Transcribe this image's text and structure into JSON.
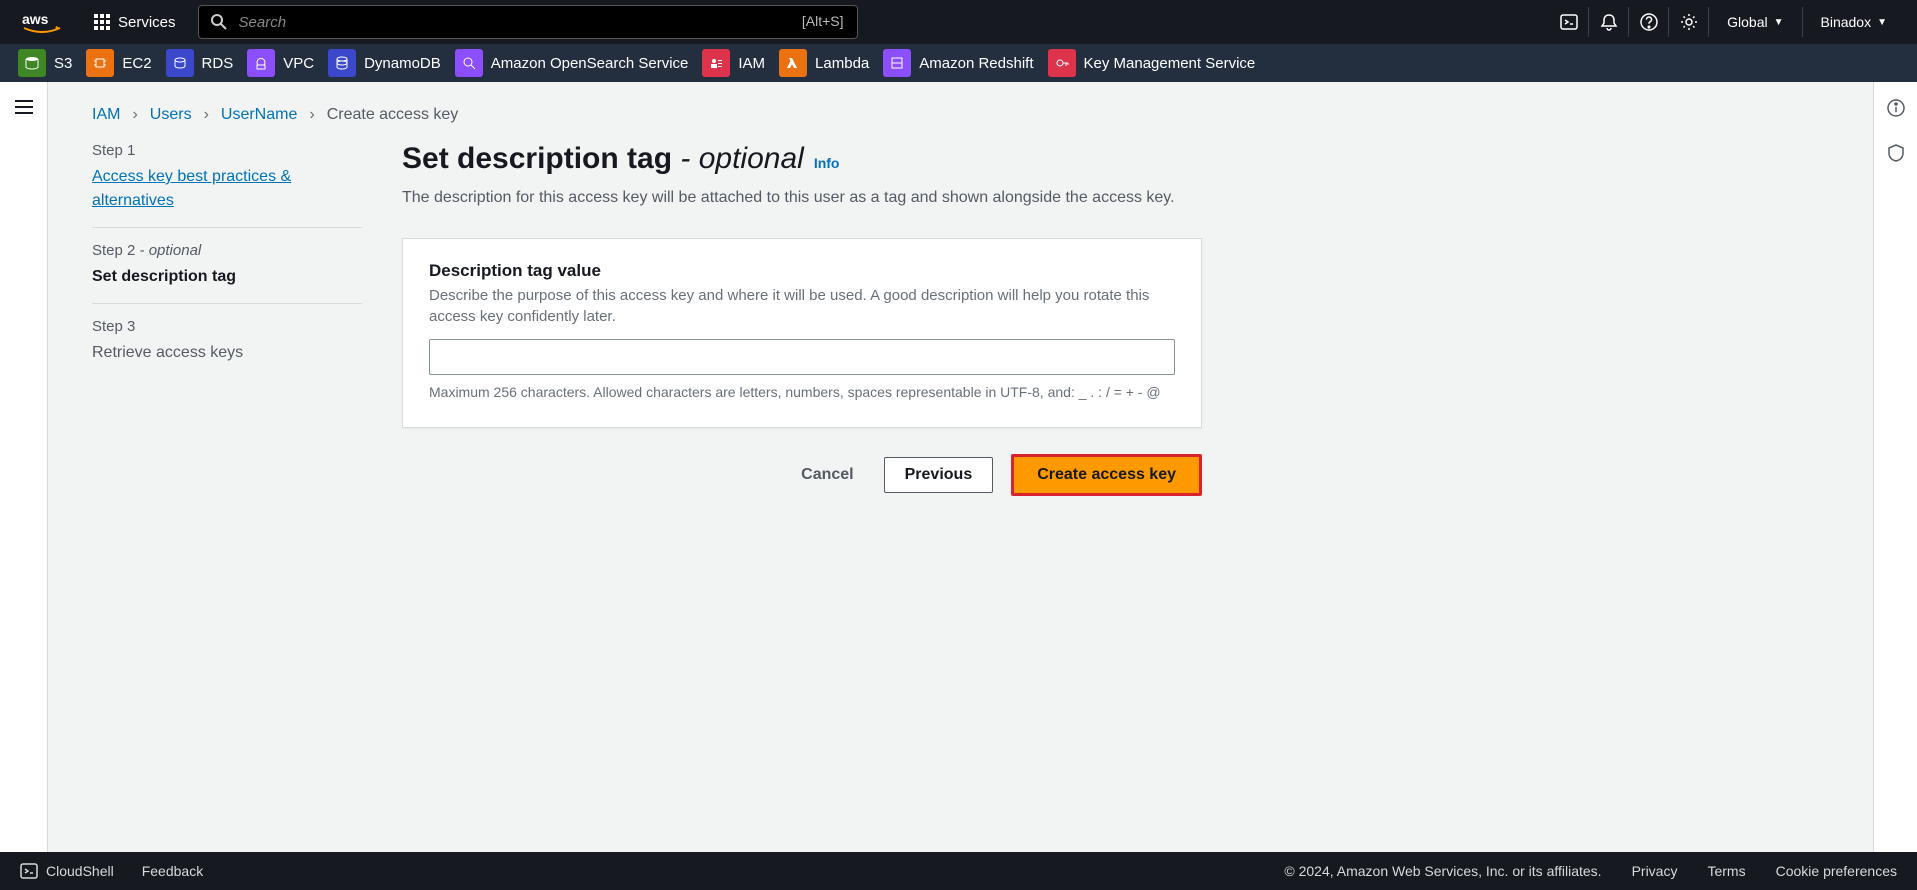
{
  "topnav": {
    "services_label": "Services",
    "search_placeholder": "Search",
    "search_shortcut": "[Alt+S]",
    "region_label": "Global",
    "account_label": "Binadox"
  },
  "service_shortcuts": [
    {
      "name": "S3",
      "icon_class": "svc-s3"
    },
    {
      "name": "EC2",
      "icon_class": "svc-ec2"
    },
    {
      "name": "RDS",
      "icon_class": "svc-rds"
    },
    {
      "name": "VPC",
      "icon_class": "svc-vpc"
    },
    {
      "name": "DynamoDB",
      "icon_class": "svc-dynamo"
    },
    {
      "name": "Amazon OpenSearch Service",
      "icon_class": "svc-opensearch"
    },
    {
      "name": "IAM",
      "icon_class": "svc-iam"
    },
    {
      "name": "Lambda",
      "icon_class": "svc-lambda"
    },
    {
      "name": "Amazon Redshift",
      "icon_class": "svc-redshift"
    },
    {
      "name": "Key Management Service",
      "icon_class": "svc-kms"
    }
  ],
  "breadcrumb": {
    "items": [
      "IAM",
      "Users",
      "UserName"
    ],
    "current": "Create access key"
  },
  "wizard": {
    "step1_num": "Step 1",
    "step1_title": "Access key best practices & alternatives",
    "step2_num": "Step 2",
    "step2_opt": " - optional",
    "step2_title": "Set description tag",
    "step3_num": "Step 3",
    "step3_title": "Retrieve access keys"
  },
  "page": {
    "title_main": "Set description tag ",
    "title_opt": "- optional",
    "info_label": "Info",
    "description": "The description for this access key will be attached to this user as a tag and shown alongside the access key.",
    "field_label": "Description tag value",
    "field_help": "Describe the purpose of this access key and where it will be used. A good description will help you rotate this access key confidently later.",
    "field_value": "",
    "field_hint": "Maximum 256 characters. Allowed characters are letters, numbers, spaces representable in UTF-8, and: _ . : / = + - @"
  },
  "actions": {
    "cancel": "Cancel",
    "previous": "Previous",
    "create": "Create access key"
  },
  "footer": {
    "cloudshell": "CloudShell",
    "feedback": "Feedback",
    "copyright": "© 2024, Amazon Web Services, Inc. or its affiliates.",
    "privacy": "Privacy",
    "terms": "Terms",
    "cookies": "Cookie preferences"
  }
}
